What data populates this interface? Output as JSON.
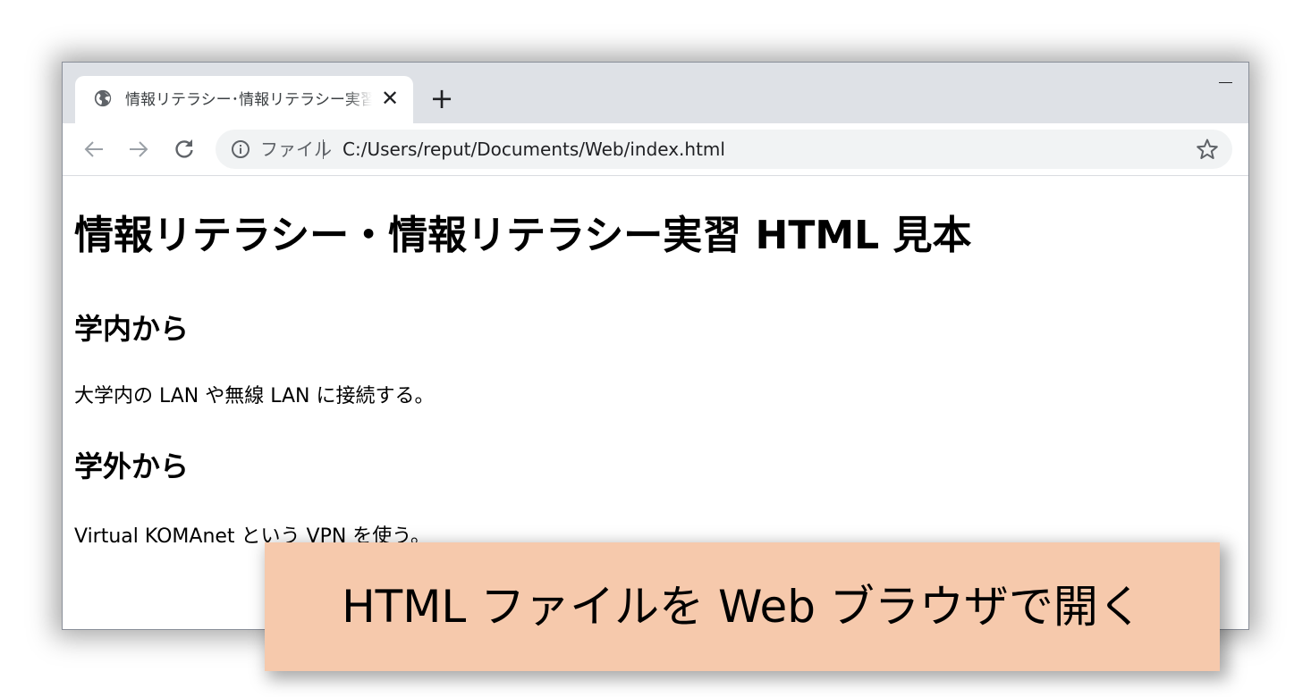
{
  "browser": {
    "tab": {
      "title": "情報リテラシー･情報リテラシー実習 HTML 見本",
      "close_symbol": "✕",
      "icon": "globe-icon"
    },
    "new_tab_symbol": "+",
    "nav": {
      "back_icon": "arrow-left-icon",
      "forward_icon": "arrow-right-icon",
      "reload_icon": "reload-icon"
    },
    "address_bar": {
      "scheme_label": "ファイル",
      "url": "C:/Users/reput/Documents/Web/index.html",
      "info_icon": "info-icon",
      "bookmark_icon": "star-icon"
    },
    "minimize_icon": "minimize-icon"
  },
  "page": {
    "heading": "情報リテラシー・情報リテラシー実習 HTML 見本",
    "sections": [
      {
        "heading": "学内から",
        "text": "大学内の LAN や無線 LAN に接続する。"
      },
      {
        "heading": "学外から",
        "text": "Virtual KOMAnet という VPN を使う。"
      }
    ]
  },
  "caption": {
    "text": "HTML ファイルを Web ブラウザで開く",
    "background": "#f6c9ac"
  },
  "colors": {
    "titlebar": "#dee1e6",
    "omnibox": "#f1f3f4",
    "icon_gray": "#5f6368"
  }
}
